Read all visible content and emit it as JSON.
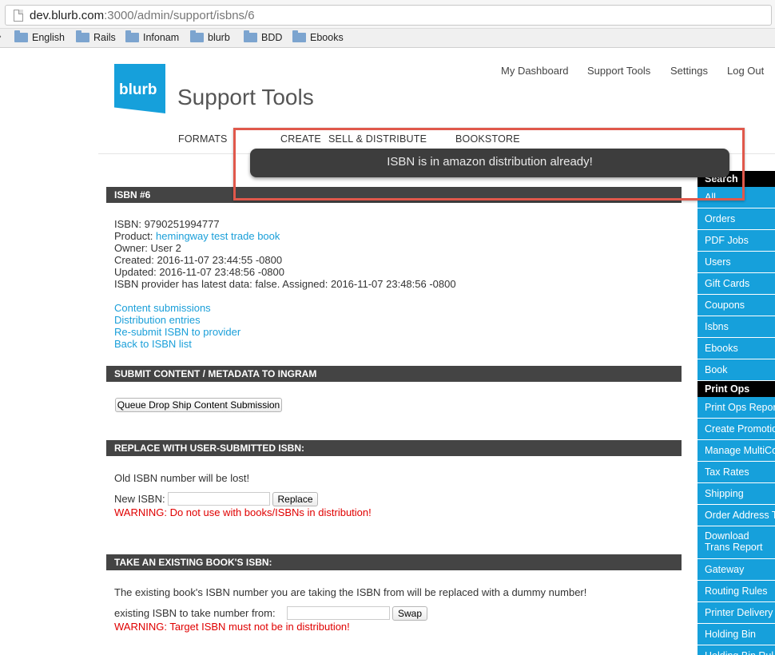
{
  "browser": {
    "url_host": "dev.blurb.com",
    "url_path": ":3000/admin/support/isbns/6",
    "bookmarks": [
      "English",
      "Rails",
      "Infonam",
      "blurb",
      "BDD",
      "Ebooks"
    ]
  },
  "header": {
    "logo_text": "blurb",
    "title": "Support Tools",
    "top_links": [
      "My Dashboard",
      "Support Tools",
      "Settings",
      "Log Out"
    ],
    "nav": [
      "FORMATS",
      "CREATE",
      "SELL & DISTRIBUTE",
      "BOOKSTORE"
    ]
  },
  "flash": {
    "message": "ISBN is in amazon distribution already!"
  },
  "isbn_section": {
    "heading": "ISBN #6",
    "isbn_label": "ISBN: 9790251994777",
    "product_label": "Product: ",
    "product_link": "hemingway test trade book",
    "owner": "Owner: User 2",
    "created": "Created: 2016-11-07 23:44:55 -0800",
    "updated": "Updated: 2016-11-07 23:48:56 -0800",
    "provider_status": "ISBN provider has latest data: false. Assigned: 2016-11-07 23:48:56 -0800",
    "links": [
      "Content submissions",
      "Distribution entries",
      "Re-submit ISBN to provider",
      "Back to ISBN list"
    ]
  },
  "submit_section": {
    "heading": "SUBMIT CONTENT / METADATA TO INGRAM",
    "button": "Queue Drop Ship Content Submission"
  },
  "replace_section": {
    "heading": "REPLACE WITH USER-SUBMITTED ISBN:",
    "note": "Old ISBN number will be lost!",
    "field_label": "New ISBN:",
    "field_value": "",
    "button": "Replace",
    "warning": "WARNING: Do not use with books/ISBNs in distribution!"
  },
  "take_section": {
    "heading": "TAKE AN EXISTING BOOK'S ISBN:",
    "note": "The existing book's ISBN number you are taking the ISBN from will be replaced with a dummy number!",
    "field_label": "existing ISBN to take number from:",
    "field_value": "",
    "button": "Swap",
    "warning": "WARNING: Target ISBN must not be in distribution!"
  },
  "sidebar": {
    "search_heading": "Search",
    "search_items": [
      "All",
      "Orders",
      "PDF Jobs",
      "Users",
      "Gift Cards",
      "Coupons",
      "Isbns",
      "Ebooks",
      "Book"
    ],
    "printops_heading": "Print Ops",
    "printops_items": [
      "Print Ops Repor",
      "Create Promotio",
      "Manage MultiCo",
      "Tax Rates",
      "Shipping",
      "Order Address T",
      "Download Trans Report",
      "Gateway",
      "Routing Rules",
      "Printer Delivery",
      "Holding Bin",
      "Holding Bin Rul"
    ]
  },
  "colors": {
    "brand": "#16a0db",
    "flash_bg": "#3d3d3d",
    "warning": "#e00000",
    "highlight": "#e0584b"
  }
}
